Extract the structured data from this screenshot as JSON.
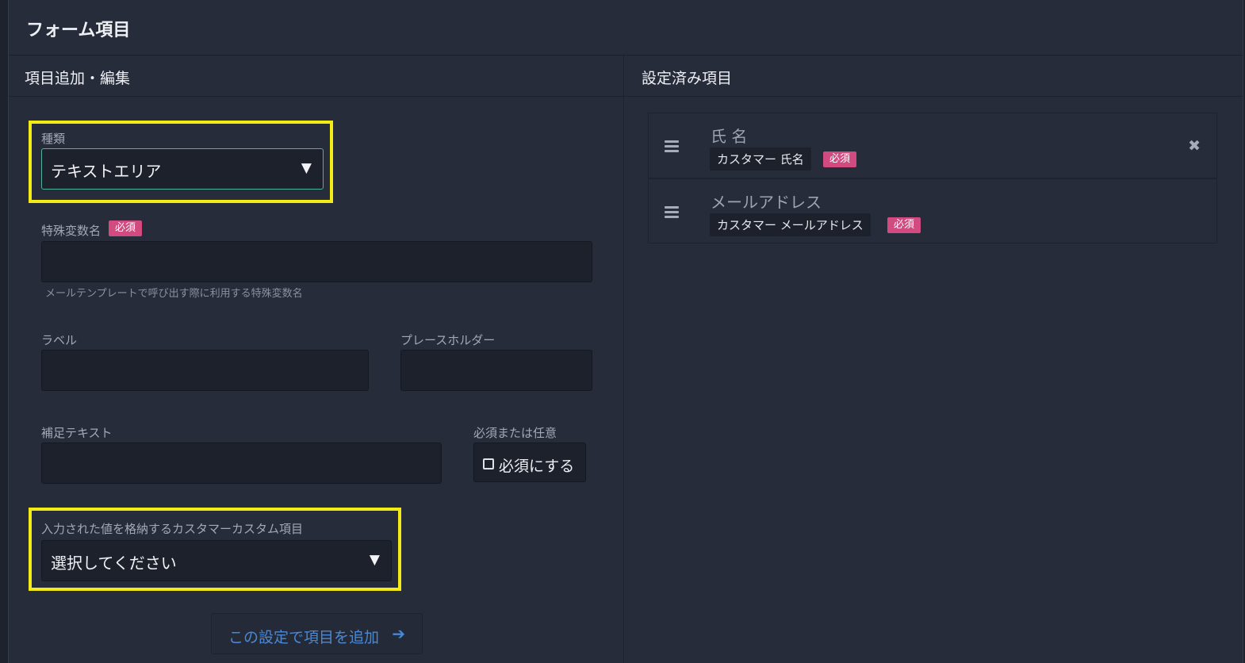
{
  "page": {
    "title": "フォーム項目"
  },
  "editor": {
    "title": "項目追加・編集",
    "type": {
      "label": "種類",
      "value": "テキストエリア"
    },
    "variable": {
      "label": "特殊変数名",
      "badge": "必須",
      "value": "",
      "hint": "メールテンプレートで呼び出す際に利用する特殊変数名"
    },
    "label_field": {
      "label": "ラベル",
      "value": ""
    },
    "placeholder_field": {
      "label": "プレースホルダー",
      "value": ""
    },
    "note_field": {
      "label": "補足テキスト",
      "value": ""
    },
    "required": {
      "label": "必須または任意",
      "checkbox_label": "必須にする",
      "checked": false
    },
    "custom_field": {
      "label": "入力された値を格納するカスタマーカスタム項目",
      "value": "選択してください"
    },
    "add_button": {
      "label": "この設定で項目を追加"
    }
  },
  "configured": {
    "title": "設定済み項目",
    "items": [
      {
        "name": "氏 名",
        "tag": "カスタマー 氏名",
        "badge": "必須"
      },
      {
        "name": "メールアドレス",
        "tag": "カスタマー メールアドレス",
        "badge": "必須"
      }
    ]
  },
  "colors": {
    "highlight": "#f4ea15",
    "badge": "#d14b80",
    "accent": "#4a88d4",
    "focus": "#4fb39b"
  },
  "icons": {
    "select_caret": "caret-down-icon",
    "drag": "drag-handle-icon",
    "delete": "close-icon",
    "add": "arrow-right-icon"
  }
}
